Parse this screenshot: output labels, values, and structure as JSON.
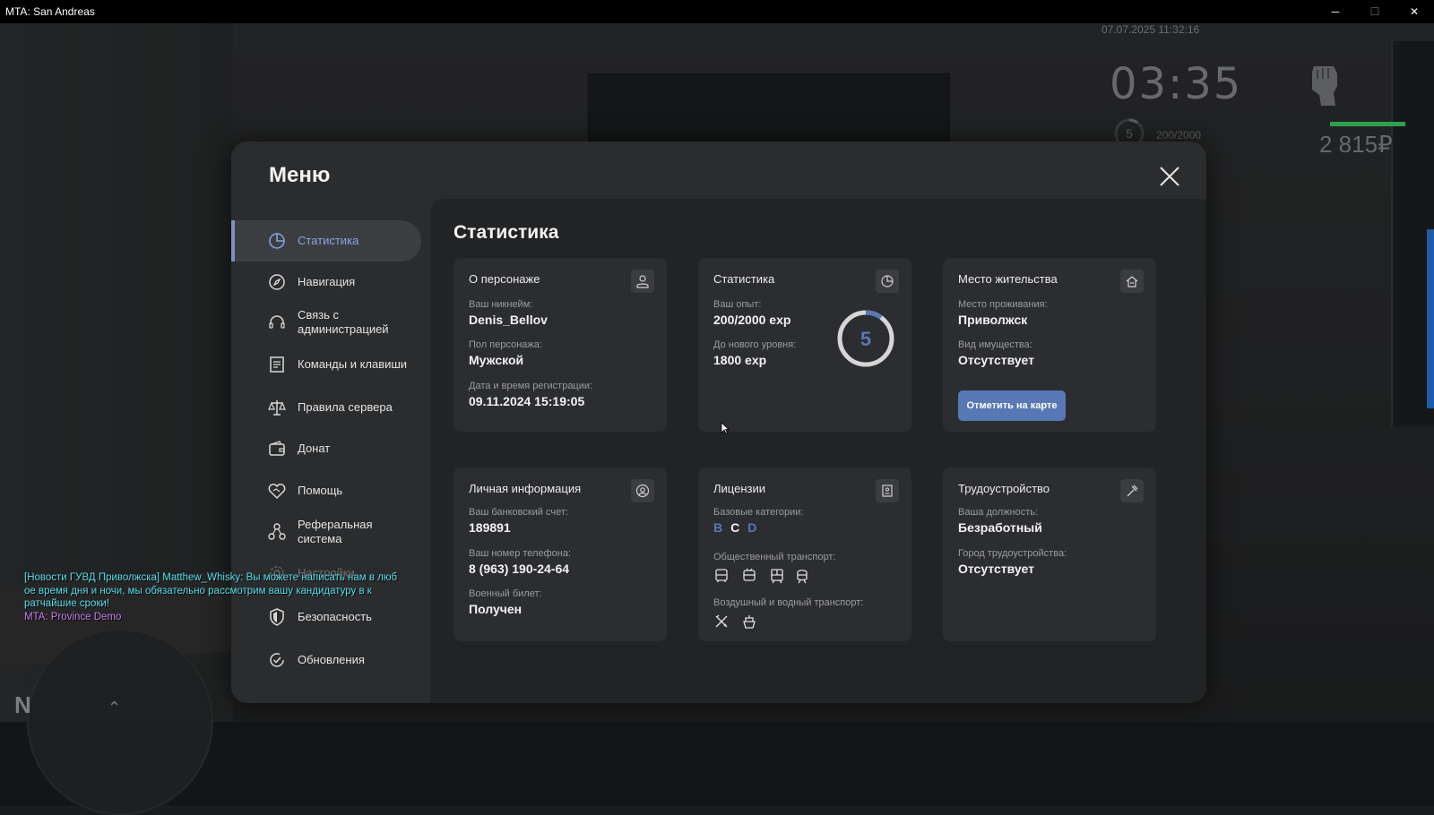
{
  "window": {
    "title": "MTA: San Andreas",
    "controls": {
      "minimize": "─",
      "maximize": "☐",
      "close": "✕"
    }
  },
  "hud": {
    "datetime": "07.07.2025 11:32:16",
    "clock": "03:35",
    "level": "5",
    "exp": "200/2000",
    "money": "2 815₽"
  },
  "chat": {
    "lines": [
      {
        "text": "[Новости ГУВД Приволжска] Matthew_Whisky: Вы можете написать нам в люб",
        "color": "#58e0ee"
      },
      {
        "text": "ое время дня и ночи, мы обязательно рассмотрим вашу кандидатуру в к",
        "color": "#58e0ee"
      },
      {
        "text": "ратчайшие сроки!",
        "color": "#58e0ee"
      },
      {
        "text": "MTA: Province Demo",
        "color": "#c77bf2"
      }
    ]
  },
  "radar": {
    "north": "N",
    "player_arrow": "⌃"
  },
  "menu": {
    "title": "Меню",
    "sidebar": [
      {
        "label": "Статистика",
        "icon": "chart-pie-icon",
        "active": true
      },
      {
        "label": "Навигация",
        "icon": "compass-icon"
      },
      {
        "label": "Связь с\nадминистрацией",
        "icon": "headset-icon"
      },
      {
        "label": "Команды и клавиши",
        "icon": "document-list-icon"
      },
      {
        "label": "Правила сервера",
        "icon": "scales-icon"
      },
      {
        "label": "Донат",
        "icon": "wallet-icon"
      },
      {
        "label": "Помощь",
        "icon": "heart-handshake-icon"
      },
      {
        "label": "Реферальная\nсистема",
        "icon": "network-icon"
      },
      {
        "label": "Настройки",
        "icon": "gear-icon"
      },
      {
        "label": "Безопасность",
        "icon": "shield-icon"
      },
      {
        "label": "Обновления",
        "icon": "refresh-check-icon"
      }
    ],
    "content_title": "Статистика",
    "cards": {
      "character": {
        "title": "О персонаже",
        "icon": "person-icon",
        "nickname_label": "Ваш никнейм:",
        "nickname": "Denis_Bellov",
        "gender_label": "Пол персонажа:",
        "gender": "Мужской",
        "reg_label": "Дата и время регистрации:",
        "reg_date": "09.11.2024 15:19:05"
      },
      "stats": {
        "title": "Статистика",
        "icon": "chart-pie-icon",
        "exp_label": "Ваш опыт:",
        "exp": "200/2000 exp",
        "next_label": "До нового уровня:",
        "next": "1800 exp",
        "level": "5",
        "progress": 0.1
      },
      "residence": {
        "title": "Место жительства",
        "icon": "house-icon",
        "place_label": "Место проживания:",
        "place": "Приволжск",
        "property_label": "Вид имущества:",
        "property": "Отсутствует",
        "map_button": "Отметить на карте"
      },
      "personal": {
        "title": "Личная информация",
        "icon": "user-circle-icon",
        "bank_label": "Ваш банковский счет:",
        "bank": "189891",
        "phone_label": "Ваш номер телефона:",
        "phone": "8 (963) 190-24-64",
        "military_label": "Военный билет:",
        "military": "Получен"
      },
      "licenses": {
        "title": "Лицензии",
        "icon": "license-icon",
        "base_label": "Базовые категории:",
        "categories": [
          {
            "letter": "B",
            "color": "#5878b5"
          },
          {
            "letter": "C",
            "color": "#f2f2f2"
          },
          {
            "letter": "D",
            "color": "#5878b5"
          }
        ],
        "public_label": "Общественный транспорт:",
        "public_icons": [
          "bus-icon",
          "trolleybus-icon",
          "tram-icon",
          "metro-icon"
        ],
        "air_label": "Воздушный и водный транспорт:",
        "air_icons": [
          "airplane-icon",
          "boat-icon"
        ]
      },
      "employment": {
        "title": "Трудоустройство",
        "icon": "hammer-icon",
        "position_label": "Ваша должность:",
        "position": "Безработный",
        "city_label": "Город трудоустройства:",
        "city": "Отсутствует"
      }
    }
  },
  "colors": {
    "accent": "#5878b5",
    "active_text": "#8aa4e6",
    "panel": "#2b2c2e",
    "card": "#2c2d30",
    "health_bar": "#2ea04f"
  }
}
